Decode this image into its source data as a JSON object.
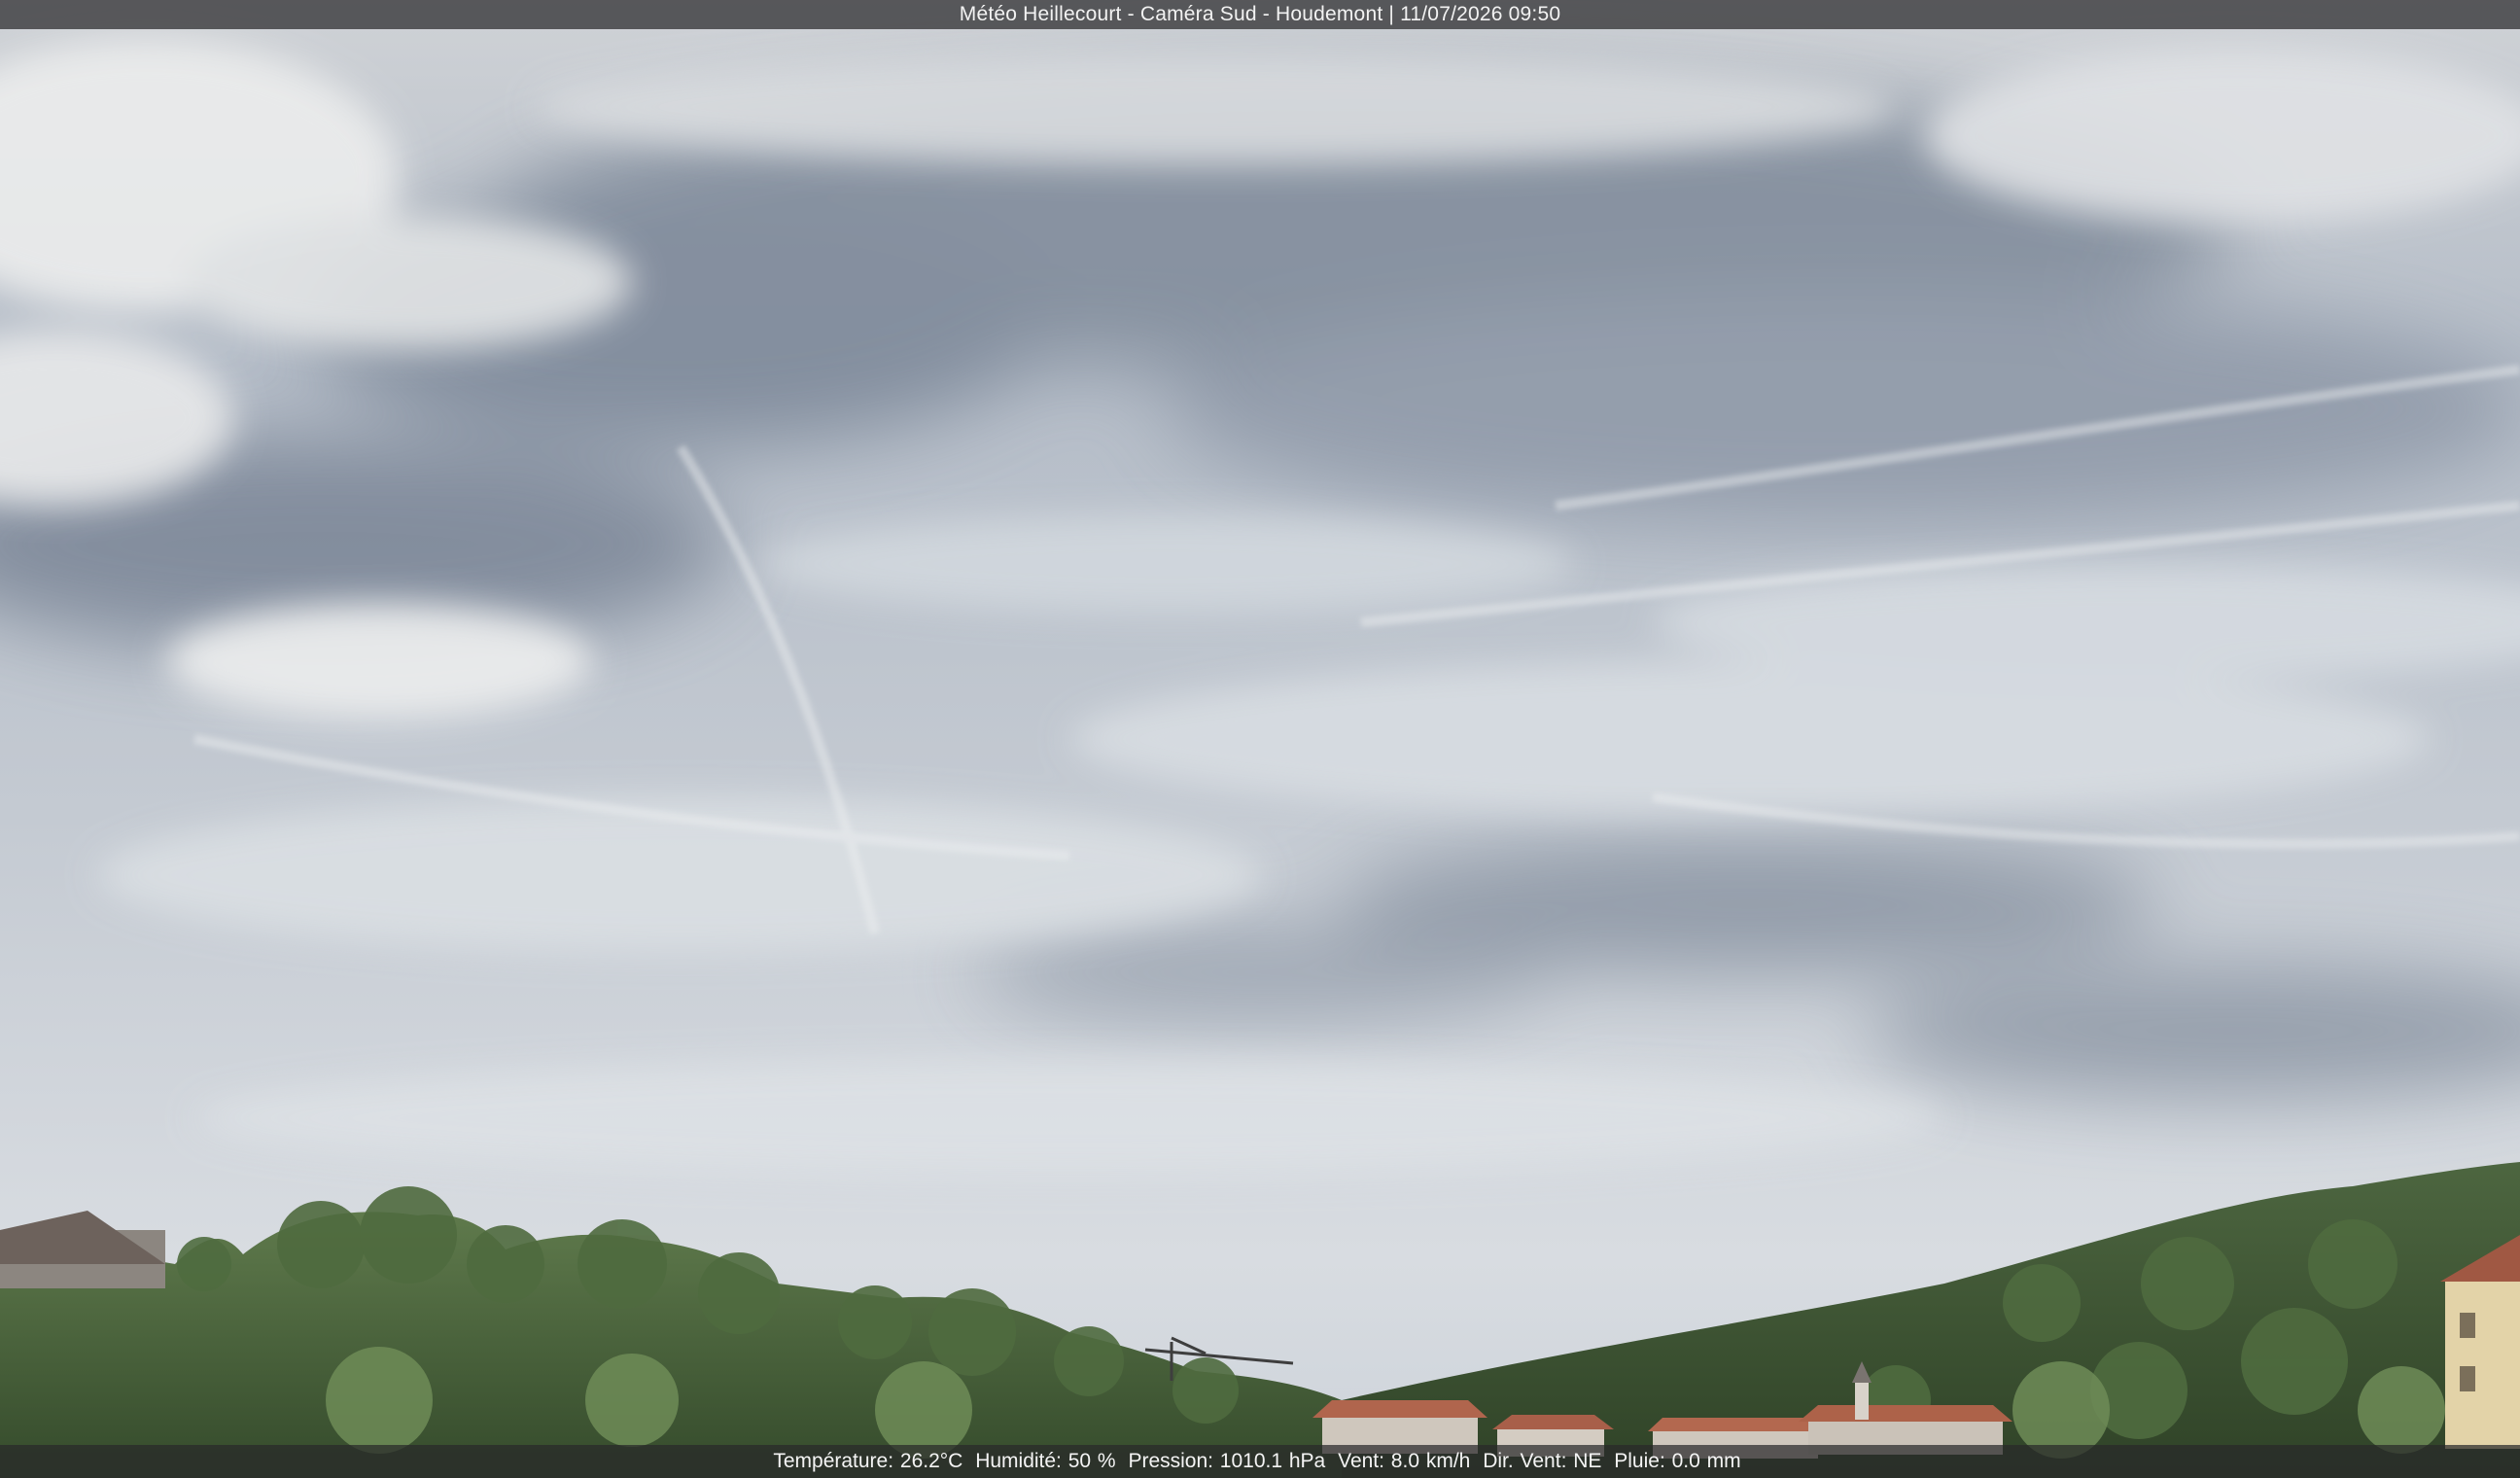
{
  "webcam": {
    "title": "Météo Heillecourt - Caméra Sud - Houdemont | 11/07/2026 09:50",
    "readings": {
      "temperature": "Température: 26.2°C",
      "humidity": "Humidité: 50 %",
      "pressure": "Pression: 1010.1 hPa",
      "wind_speed": "Vent: 8.0 km/h",
      "wind_dir": "Dir. Vent: NE",
      "rain": "Pluie: 0.0 mm"
    }
  },
  "colors": {
    "sky_top": "#c9ccd0",
    "sky_mid": "#aab4c2",
    "sky_low": "#d7dbe0",
    "cloud_dark": "#7d8898",
    "foliage": "#3f5a33",
    "roof": "#b0654d",
    "overlay": "#3c3c3e"
  }
}
